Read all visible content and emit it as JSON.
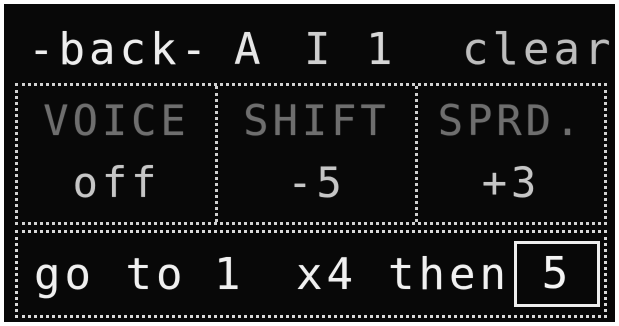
{
  "header": {
    "back_label": "-back-",
    "pattern_label": "A",
    "step_label": "I",
    "index_label": "1",
    "clear_label": "clear"
  },
  "params": [
    {
      "label": "VOICE",
      "value": "off"
    },
    {
      "label": "SHIFT",
      "value": "-5"
    },
    {
      "label": "SPRD.",
      "value": "+3"
    }
  ],
  "footer": {
    "goto_label": "go to",
    "goto_value": "1",
    "repeat_label": "x4",
    "then_label": "then",
    "then_value": "5"
  },
  "colors": {
    "background": "#080808",
    "text": "#e9e9e9",
    "label_dim": "#6e6e6e",
    "border": "#d2d2d2"
  }
}
